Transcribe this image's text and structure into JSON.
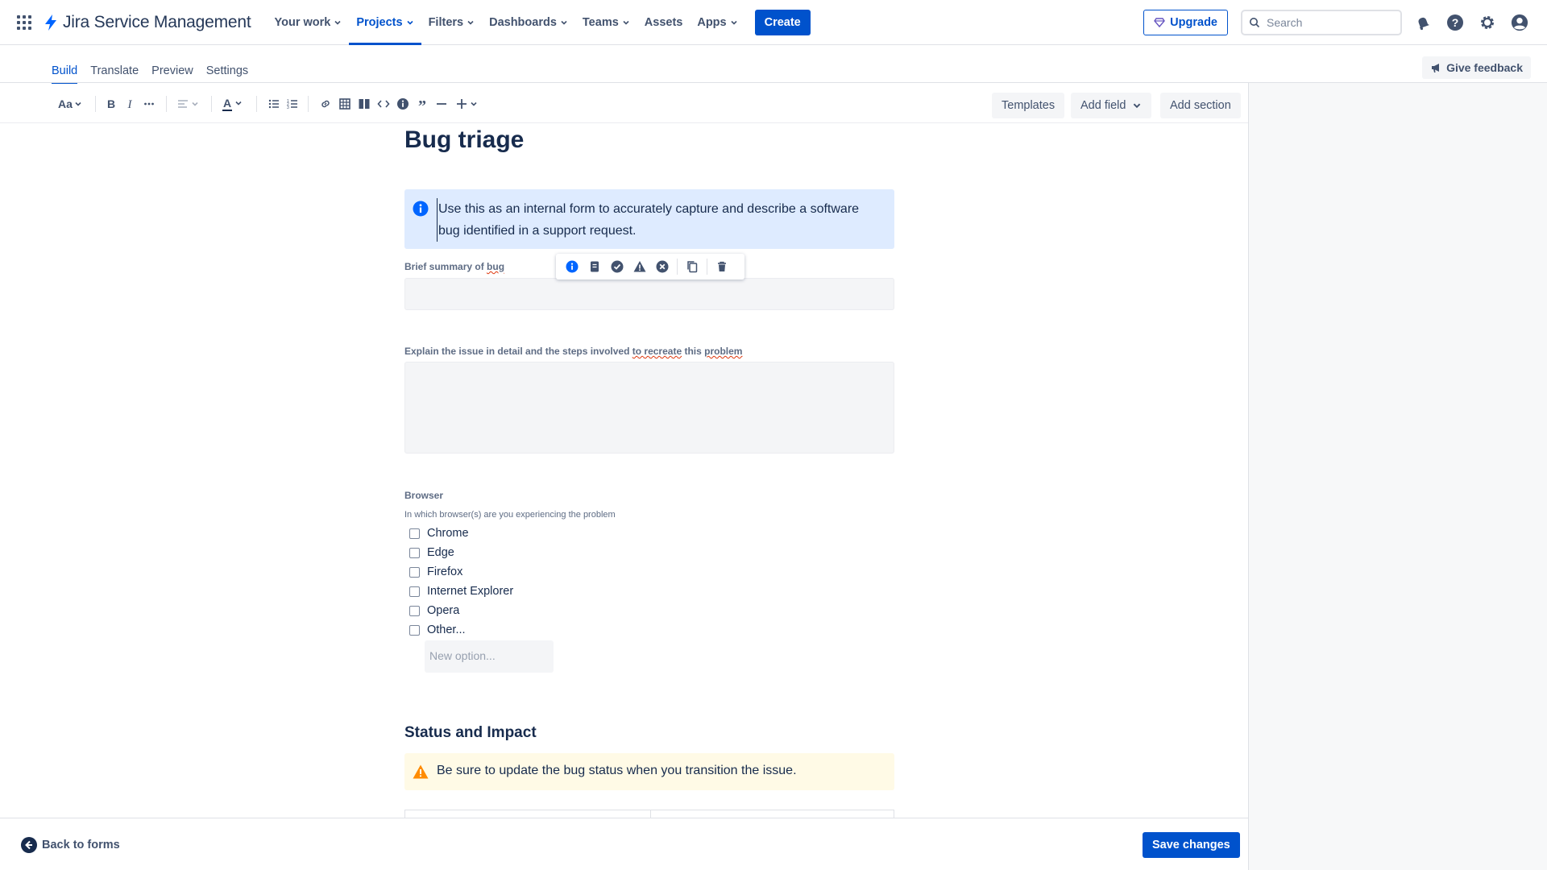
{
  "nav": {
    "logo_text": "Jira Service Management",
    "items": [
      {
        "label": "Your work"
      },
      {
        "label": "Projects"
      },
      {
        "label": "Filters"
      },
      {
        "label": "Dashboards"
      },
      {
        "label": "Teams"
      },
      {
        "label": "Assets"
      },
      {
        "label": "Apps"
      }
    ],
    "create_label": "Create",
    "upgrade_label": "Upgrade",
    "search_placeholder": "Search"
  },
  "tabs": [
    "Build",
    "Translate",
    "Preview",
    "Settings"
  ],
  "feedback_label": "Give feedback",
  "toolbar": {
    "text_style_label": "Aa",
    "color_label": "A",
    "templates_label": "Templates",
    "add_field_label": "Add field",
    "add_section_label": "Add section"
  },
  "form": {
    "title": "Bug triage",
    "info_text": "Use this as an internal form to accurately capture and describe a software bug identified in a support request.",
    "q1": {
      "label_a": "Brief summary of ",
      "label_b": "bug"
    },
    "q2": {
      "label_a": "Explain the issue in detail and the steps involved ",
      "label_b": "to recreate",
      "label_c": " this ",
      "label_d": "problem"
    },
    "browser": {
      "label": "Browser",
      "helper": "In which browser(s) are you experiencing the problem",
      "options": [
        "Chrome",
        "Edge",
        "Firefox",
        "Internet Explorer",
        "Opera",
        "Other..."
      ],
      "new_option_placeholder": "New option..."
    },
    "section_title": "Status and Impact",
    "warning_text": "Be sure to update the bug status when you transition the issue."
  },
  "footer": {
    "back_label": "Back to forms",
    "save_label": "Save changes"
  },
  "colors": {
    "primary": "#0052cc",
    "info_bg": "#deebff",
    "warning_bg": "#fffae6",
    "warning_icon": "#ff8b00",
    "text": "#172b4d"
  },
  "icons": {
    "nav": [
      "app-switcher-icon",
      "jira-logo-icon",
      "gem-icon",
      "search-icon",
      "notification-bell-icon",
      "help-icon",
      "settings-gear-icon",
      "profile-avatar-icon"
    ],
    "panel": [
      "info-icon",
      "note-icon",
      "success-icon",
      "warning-icon",
      "error-icon",
      "copy-icon",
      "delete-icon"
    ]
  }
}
